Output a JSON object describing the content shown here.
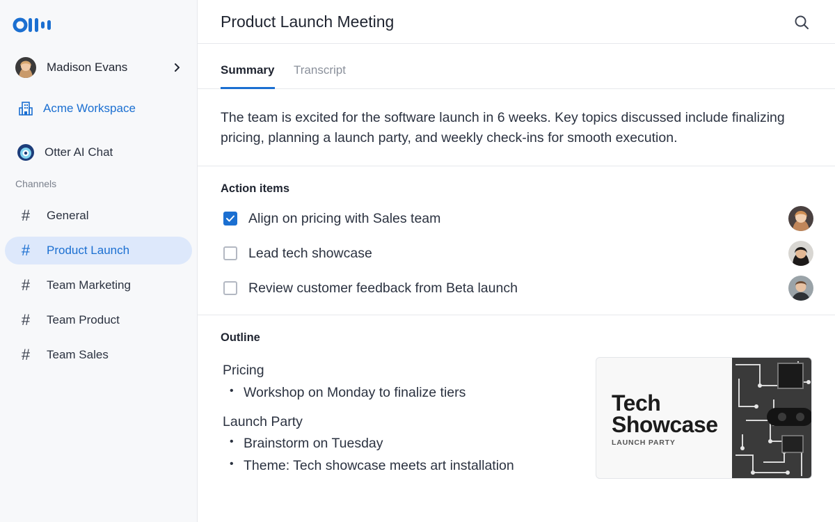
{
  "sidebar": {
    "logo": "otter-logo",
    "user": {
      "name": "Madison Evans"
    },
    "workspace": {
      "label": "Acme Workspace"
    },
    "chat": {
      "label": "Otter AI Chat"
    },
    "channels_heading": "Channels",
    "channels": [
      {
        "label": "General",
        "active": false
      },
      {
        "label": "Product Launch",
        "active": true
      },
      {
        "label": "Team Marketing",
        "active": false
      },
      {
        "label": "Team Product",
        "active": false
      },
      {
        "label": "Team Sales",
        "active": false
      }
    ]
  },
  "header": {
    "title": "Product Launch Meeting"
  },
  "tabs": [
    {
      "label": "Summary",
      "active": true
    },
    {
      "label": "Transcript",
      "active": false
    }
  ],
  "summary": {
    "text": "The team is excited for the software launch in 6 weeks. Key topics discussed include finalizing pricing, planning a launch party, and weekly check-ins for smooth execution."
  },
  "action_items": {
    "heading": "Action items",
    "items": [
      {
        "label": "Align on pricing with Sales team",
        "checked": true
      },
      {
        "label": "Lead tech showcase",
        "checked": false
      },
      {
        "label": "Review customer feedback from Beta launch",
        "checked": false
      }
    ]
  },
  "outline": {
    "heading": "Outline",
    "topics": [
      {
        "title": "Pricing",
        "bullets": [
          "Workshop on Monday to finalize tiers"
        ]
      },
      {
        "title": "Launch Party",
        "bullets": [
          "Brainstorm on Tuesday",
          "Theme: Tech showcase meets art installation"
        ]
      }
    ],
    "card": {
      "title_line1": "Tech",
      "title_line2": "Showcase",
      "subtitle": "LAUNCH PARTY"
    }
  },
  "colors": {
    "accent": "#1b6fd1",
    "active_bg": "#dde8fb",
    "sidebar_bg": "#f7f8fa"
  }
}
